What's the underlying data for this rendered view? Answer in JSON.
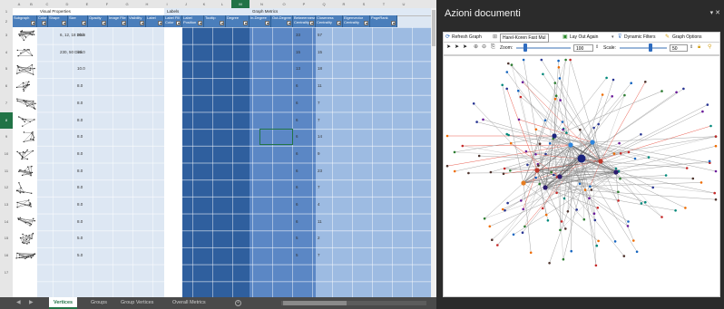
{
  "spreadsheet": {
    "column_letters": [
      "A",
      "B",
      "C",
      "D",
      "E",
      "F",
      "G",
      "H",
      "I",
      "J",
      "K",
      "L",
      "M",
      "N",
      "O",
      "P",
      "Q",
      "R",
      "S",
      "T",
      "U"
    ],
    "selected_column": "M",
    "row_numbers": [
      "1",
      "2",
      "3",
      "4",
      "5",
      "6",
      "7",
      "8",
      "9",
      "10",
      "11",
      "12",
      "13",
      "14",
      "15",
      "16",
      "17"
    ],
    "selected_row": "8",
    "group_headers": {
      "visual_properties": "Visual Properties",
      "labels": "Labels",
      "graph_metrics": "Graph Metrics"
    },
    "field_headers": [
      "Subgraph",
      "Color",
      "Shape",
      "Size",
      "Opacity",
      "Image File",
      "Visibility",
      "Label",
      "Label Fill Color",
      "Label Position",
      "Tooltip",
      "Degree",
      "In-Degree",
      "Out-Degree",
      "Betweenness Centrality",
      "Closeness Centrality",
      "Eigenvector Centrality",
      "PageRank"
    ],
    "rows": [
      {
        "shape": "6, 12, 18 Disk",
        "size": "30.0",
        "in_degree": "33",
        "out_degree": "57"
      },
      {
        "shape": "230, 50 Disk",
        "size": "15.0",
        "in_degree": "15",
        "out_degree": "15"
      },
      {
        "shape": "",
        "size": "10.0",
        "in_degree": "13",
        "out_degree": "18"
      },
      {
        "shape": "",
        "size": "8.0",
        "in_degree": "6",
        "out_degree": "11"
      },
      {
        "shape": "",
        "size": "8.0",
        "in_degree": "6",
        "out_degree": "7"
      },
      {
        "shape": "",
        "size": "8.0",
        "in_degree": "6",
        "out_degree": "7"
      },
      {
        "shape": "",
        "size": "8.0",
        "in_degree": "6",
        "out_degree": "14"
      },
      {
        "shape": "",
        "size": "8.0",
        "in_degree": "6",
        "out_degree": "9"
      },
      {
        "shape": "",
        "size": "8.0",
        "in_degree": "6",
        "out_degree": "23"
      },
      {
        "shape": "",
        "size": "8.0",
        "in_degree": "6",
        "out_degree": "7"
      },
      {
        "shape": "",
        "size": "8.0",
        "in_degree": "6",
        "out_degree": "4"
      },
      {
        "shape": "",
        "size": "8.0",
        "in_degree": "6",
        "out_degree": "11"
      },
      {
        "shape": "",
        "size": "5.0",
        "in_degree": "5",
        "out_degree": "2"
      },
      {
        "shape": "",
        "size": "5.0",
        "in_degree": "5",
        "out_degree": "7"
      }
    ],
    "tabs": [
      "Vertices",
      "Groups",
      "Group Vertices",
      "Overall Metrics"
    ],
    "active_tab": "Vertices",
    "colors": {
      "header_blue": "#4a7ebb",
      "dark_band": "#2f5f9e",
      "mid_band": "#5b87c5",
      "light_band": "#9dbbe2",
      "pale_band": "#dde7f3",
      "excel_green": "#217346"
    }
  },
  "task_pane": {
    "title": "Azioni documenti",
    "toolbar1": {
      "refresh": "Refresh Graph",
      "layout_select": "Harel-Koren Fast Mul",
      "lay_out_again": "Lay Out Again",
      "dynamic_filters": "Dynamic Filters",
      "graph_options": "Graph Options"
    },
    "toolbar2": {
      "zoom_label": "Zoom:",
      "zoom_value": "100",
      "scale_label": "Scale:",
      "scale_value": "50"
    },
    "icons": [
      "refresh-icon",
      "layout-icon",
      "lay-out-again-icon",
      "filter-icon",
      "graph-options-icon",
      "select-arrow-icon",
      "select-subgroup-icon",
      "select-tree-icon",
      "zoom-in-icon",
      "zoom-out-icon",
      "copy-image-icon",
      "lock-icon",
      "pin-icon"
    ]
  }
}
